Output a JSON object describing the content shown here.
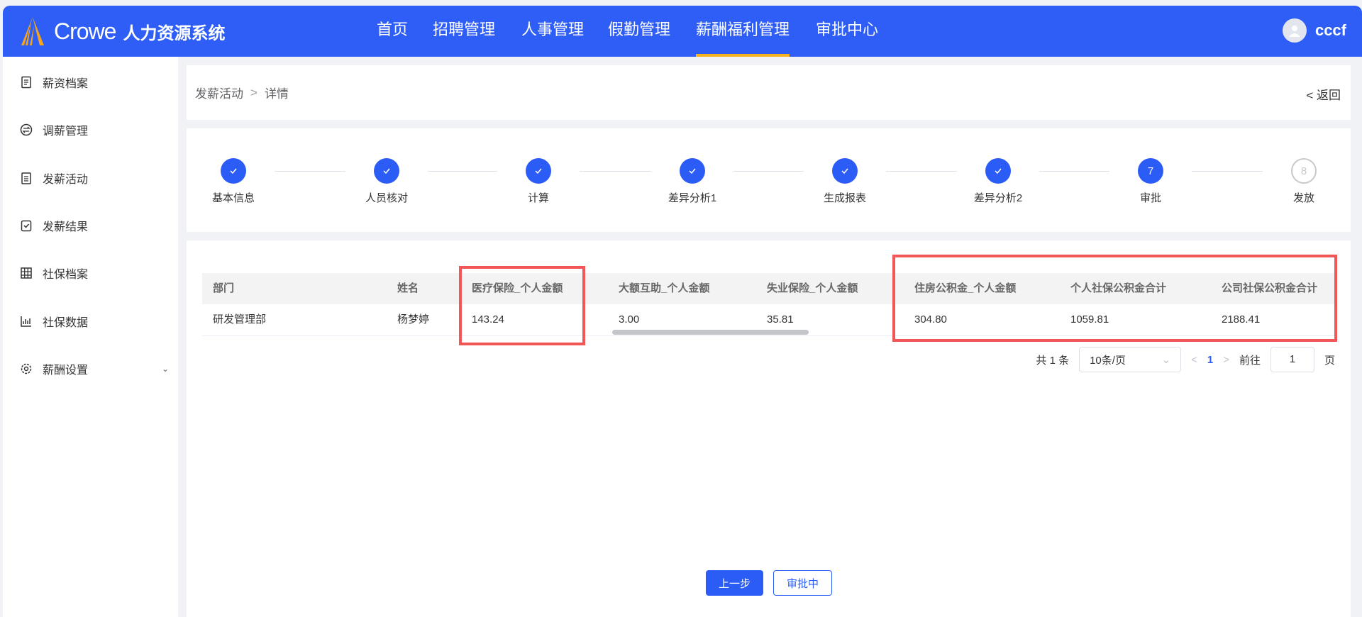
{
  "header": {
    "brand": "Crowe",
    "system": "人力资源系统",
    "nav": [
      "首页",
      "招聘管理",
      "人事管理",
      "假勤管理",
      "薪酬福利管理",
      "审批中心"
    ],
    "active_nav": "薪酬福利管理",
    "user": "cccf"
  },
  "sidebar": {
    "items": [
      {
        "label": "薪资档案",
        "icon": "document-icon"
      },
      {
        "label": "调薪管理",
        "icon": "exchange-icon"
      },
      {
        "label": "发薪活动",
        "icon": "clipboard-icon"
      },
      {
        "label": "发薪结果",
        "icon": "clipboard-check-icon"
      },
      {
        "label": "社保档案",
        "icon": "grid-icon"
      },
      {
        "label": "社保数据",
        "icon": "bar-chart-icon"
      },
      {
        "label": "薪酬设置",
        "icon": "gear-icon"
      }
    ]
  },
  "breadcrumb": {
    "items": [
      "发薪活动",
      "详情"
    ],
    "back": "返回"
  },
  "steps": [
    {
      "label": "基本信息",
      "status": "done"
    },
    {
      "label": "人员核对",
      "status": "done"
    },
    {
      "label": "计算",
      "status": "done"
    },
    {
      "label": "差异分析1",
      "status": "done"
    },
    {
      "label": "生成报表",
      "status": "done"
    },
    {
      "label": "差异分析2",
      "status": "done"
    },
    {
      "label": "审批",
      "status": "current",
      "num": "7"
    },
    {
      "label": "发放",
      "status": "pending",
      "num": "8"
    }
  ],
  "table": {
    "columns": [
      "部门",
      "姓名",
      "医疗保险_个人金额",
      "大额互助_个人金额",
      "失业保险_个人金额",
      "住房公积金_个人金额",
      "个人社保公积金合计",
      "公司社保公积金合计"
    ],
    "rows": [
      [
        "研发管理部",
        "杨梦婷",
        "143.24",
        "3.00",
        "35.81",
        "304.80",
        "1059.81",
        "2188.41"
      ]
    ]
  },
  "pagination": {
    "total": "共 1 条",
    "page_size": "10条/页",
    "current": "1",
    "goto_label": "前往",
    "goto_value": "1",
    "page_suffix": "页"
  },
  "buttons": {
    "prev": "上一步",
    "status": "审批中"
  },
  "colors": {
    "primary": "#2f5ef6",
    "accent": "#f5b21c",
    "highlight": "#f25656"
  }
}
